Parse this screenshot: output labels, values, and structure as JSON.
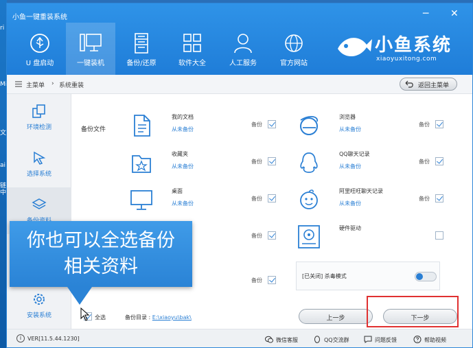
{
  "window": {
    "title": "小鱼一键重装系统",
    "minimize": "─",
    "close": "✕"
  },
  "desktop": {
    "labels": [
      "ri",
      "Mi",
      "文",
      "ai",
      "链",
      "中"
    ]
  },
  "nav": [
    {
      "label": "U 盘启动",
      "icon": "usb-icon"
    },
    {
      "label": "一键装机",
      "icon": "computer-icon",
      "active": true
    },
    {
      "label": "备份/还原",
      "icon": "server-icon"
    },
    {
      "label": "软件大全",
      "icon": "apps-grid-icon"
    },
    {
      "label": "人工服务",
      "icon": "person-icon"
    },
    {
      "label": "官方网站",
      "icon": "globe-icon"
    }
  ],
  "brand": {
    "name": "小鱼系统",
    "url": "xiaoyuxitong.com"
  },
  "breadcrumb": {
    "home": "主菜单",
    "sep": "›",
    "current": "系统重装",
    "back_label": "返回主菜单"
  },
  "sidebar": [
    {
      "label": "环境检测",
      "icon": "copy-icon"
    },
    {
      "label": "选择系统",
      "icon": "pointer-icon"
    },
    {
      "label": "备份资料",
      "icon": "layers-icon",
      "active": true
    },
    {
      "label": "安装系统",
      "icon": "gear-icon"
    }
  ],
  "section_label": "备份文件",
  "backup_items_left": [
    {
      "name": "我的文档",
      "status": "从未备份",
      "icon": "document-icon",
      "checked": true
    },
    {
      "name": "收藏夹",
      "status": "从未备份",
      "icon": "favorites-folder-icon",
      "checked": true
    },
    {
      "name": "桌面",
      "status": "从未备份",
      "icon": "monitor-icon",
      "checked": true
    },
    {
      "name": "",
      "status": "",
      "icon": "",
      "checked": true
    },
    {
      "name": "",
      "status": "",
      "icon": "",
      "checked": true
    }
  ],
  "backup_items_right": [
    {
      "name": "浏览器",
      "status": "从未备份",
      "icon": "browser-icon",
      "checked": true
    },
    {
      "name": "QQ聊天记录",
      "status": "从未备份",
      "icon": "qq-icon",
      "checked": true
    },
    {
      "name": "阿里旺旺聊天记录",
      "status": "从未备份",
      "icon": "wangwang-icon",
      "checked": true
    },
    {
      "name": "硬件驱动",
      "status": "",
      "icon": "driver-icon",
      "checked": false
    }
  ],
  "checkbox_label": "备份",
  "antivirus": {
    "label": "[已关闭] 杀毒模式",
    "on": false
  },
  "select_all": {
    "label": "全选",
    "checked": true
  },
  "backup_dir": {
    "label": "备份目录 :",
    "path": "E:\\xiaoyu\\bak\\"
  },
  "buttons": {
    "prev": "上一步",
    "next": "下一步"
  },
  "callout": {
    "line1": "你也可以全选备份",
    "line2": "相关资料"
  },
  "footer": {
    "version": "VER[11.5.44.1230]",
    "links": [
      "微信客服",
      "QQ交流群",
      "问题反馈",
      "帮助视频"
    ]
  },
  "colors": {
    "header": "#2386de",
    "accent": "#2a7fd4",
    "highlight": "#e03030"
  }
}
